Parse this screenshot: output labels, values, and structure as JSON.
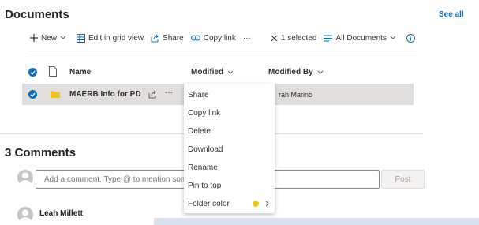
{
  "documents": {
    "title": "Documents",
    "see_all": "See all"
  },
  "toolbar": {
    "new_label": "New",
    "edit_grid_label": "Edit in grid view",
    "share_label": "Share",
    "copy_link_label": "Copy link",
    "more_label": "···",
    "selected_label": "1 selected",
    "view_label": "All Documents"
  },
  "table": {
    "columns": {
      "name": "Name",
      "modified": "Modified",
      "modified_by": "Modified By"
    },
    "rows": [
      {
        "name": "MAERB Info for PD",
        "modified_by": "rah Marino",
        "more": "···"
      }
    ]
  },
  "context_menu": {
    "items": [
      "Share",
      "Copy link",
      "Delete",
      "Download",
      "Rename",
      "Pin to top",
      "Folder color"
    ],
    "folder_color_swatch": "#f2c80f"
  },
  "comments": {
    "title": "3 Comments",
    "placeholder": "Add a comment. Type @ to mention someone",
    "post_label": "Post",
    "first_commenter": "Leah Millett"
  },
  "colors": {
    "accent": "#0f6cbd",
    "folder": "#f2c80f"
  }
}
